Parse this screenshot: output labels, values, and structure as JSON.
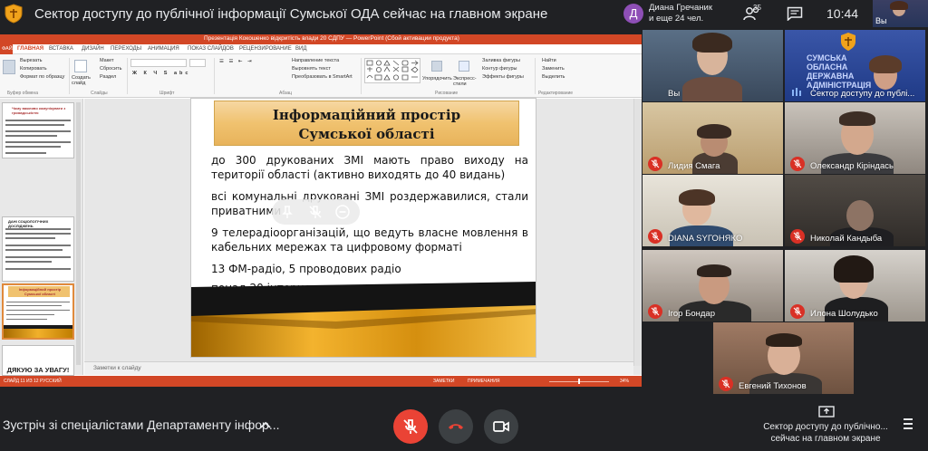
{
  "header": {
    "title": "Сектор доступу до публічної інформації Сумської ОДА сейчас на главном экране",
    "host_avatar_letter": "Д",
    "host_line1": "Диана Гречаник",
    "host_line2": "и еще 24 чел.",
    "people_count": "35",
    "clock": "10:44",
    "self_label": "Вы"
  },
  "ppt": {
    "window_title": "Презентація Кокошенко відкритість влади 20 СДПУ — PowerPoint (Сбой активации продукта)",
    "tabs": [
      "ФАЙЛ",
      "ГЛАВНАЯ",
      "ВСТАВКА",
      "ДИЗАЙН",
      "ПЕРЕХОДЫ",
      "АНИМАЦИЯ",
      "ПОКАЗ СЛАЙДОВ",
      "РЕЦЕНЗИРОВАНИЕ",
      "ВИД"
    ],
    "ribbon": {
      "cut": "Вырезать",
      "copy": "Копировать",
      "format_painter": "Формат по образцу",
      "create_slide": "Создать слайд",
      "layout": "Макет",
      "reset": "Сбросить",
      "section": "Раздел",
      "text_direction": "Направление текста",
      "align_text": "Выровнять текст",
      "smartart": "Преобразовать в SmartArt",
      "arrange": "Упорядочить",
      "quick_styles": "Экспресс-стили",
      "shape_fill": "Заливка фигуры",
      "shape_outline": "Контур фигуры",
      "shape_effects": "Эффекты фигуры",
      "find": "Найти",
      "replace": "Заменить",
      "select": "Выделить",
      "group_clipboard": "Буфер обмена",
      "group_slides": "Слайды",
      "group_font": "Шрифт",
      "group_paragraph": "Абзац",
      "group_drawing": "Рисование",
      "group_editing": "Редактирование"
    },
    "thumbnails": [
      {
        "title": "Чому важливо комунікувати з громадськістю"
      },
      {
        "title": "ДАНІ СОЦІОЛОГІЧНИХ ДОСЛІДЖЕНЬ"
      },
      {
        "title": "Інформаційний простір Сумської області"
      },
      {
        "title": "ДЯКУЮ ЗА УВАГУ!"
      }
    ],
    "notes_placeholder": "Заметки к слайду",
    "status": {
      "slide_counter": "СЛАЙД 11 ИЗ 12",
      "language": "РУССКИЙ",
      "notes": "ЗАМЕТКИ",
      "comments": "ПРИМЕЧАНИЯ",
      "zoom": "34%"
    }
  },
  "slide": {
    "title_line1": "Інформаційний простір",
    "title_line2": "Сумської області",
    "p1": "до 300 друкованих ЗМІ мають право виходу на території області (активно виходять до 40 видань)",
    "p2": "всі комунальні друковані ЗМІ роздержавилися, стали приватними",
    "p3": "9 телерадіоорганізацій, що ведуть власне мовлення в кабельних мережах та цифровому форматі",
    "p4": "13 ФМ-радіо, 5 проводових радіо",
    "p5": "понад 20 інтернет-видань"
  },
  "participants": [
    {
      "name": "Вы"
    },
    {
      "name": "Сектор доступу до публі..."
    },
    {
      "name": "Лидия Смага"
    },
    {
      "name": "Олександр Кіріндась"
    },
    {
      "name": "DIANA SYГОНЯКО"
    },
    {
      "name": "Николай Кандыба"
    },
    {
      "name": "Ігор Бондар"
    },
    {
      "name": "Илона Шолудько"
    },
    {
      "name": "Евгений Тихонов"
    }
  ],
  "presenter_tile_text": "СУМСЬКА ОБЛАСНА ДЕРЖАВНА АДМІНІСТРАЦІЯ",
  "footer": {
    "meeting_name": "Зустріч зі спеціалістами Департаменту інфор...",
    "presenting_text": "Сектор доступу до публічно... сейчас на главном экране"
  },
  "colors": {
    "meet_bg": "#202124",
    "ppt_accent": "#d24726",
    "mute_red": "#d93025",
    "slide_gold": "#f0c26f"
  }
}
